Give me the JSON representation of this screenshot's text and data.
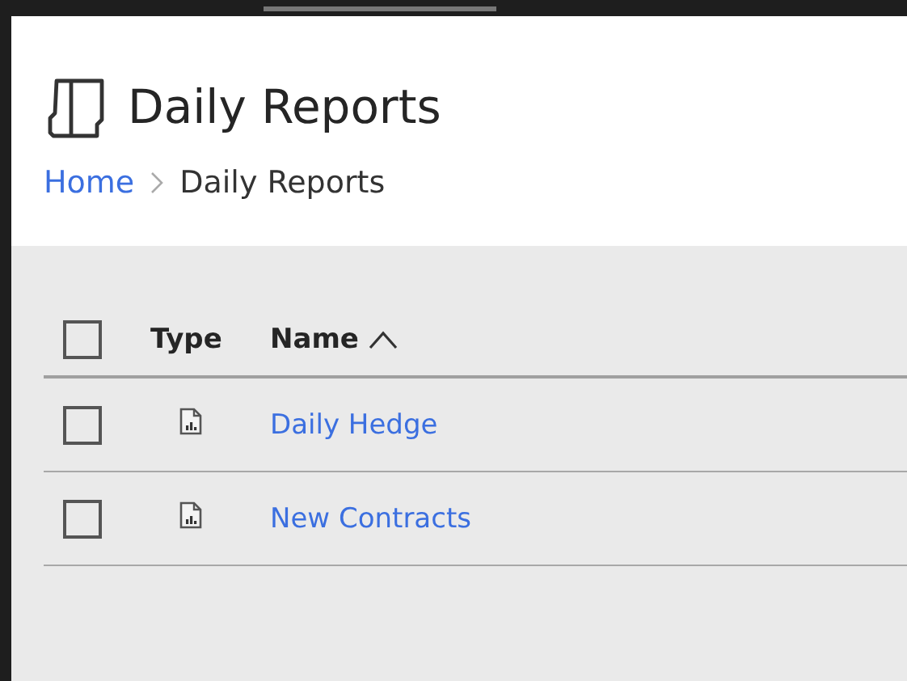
{
  "page": {
    "title": "Daily Reports"
  },
  "breadcrumb": [
    {
      "label": "Home",
      "kind": "link"
    },
    {
      "label": "Daily Reports",
      "kind": "current"
    }
  ],
  "table": {
    "select_all": {
      "checked": false
    },
    "columns": [
      {
        "label": "Type",
        "sorted": false
      },
      {
        "label": "Name",
        "sorted": true
      }
    ],
    "rows": [
      {
        "checked": false,
        "kind": "report",
        "name": "Daily Hedge"
      },
      {
        "checked": false,
        "kind": "report",
        "name": "New Contracts"
      }
    ]
  }
}
